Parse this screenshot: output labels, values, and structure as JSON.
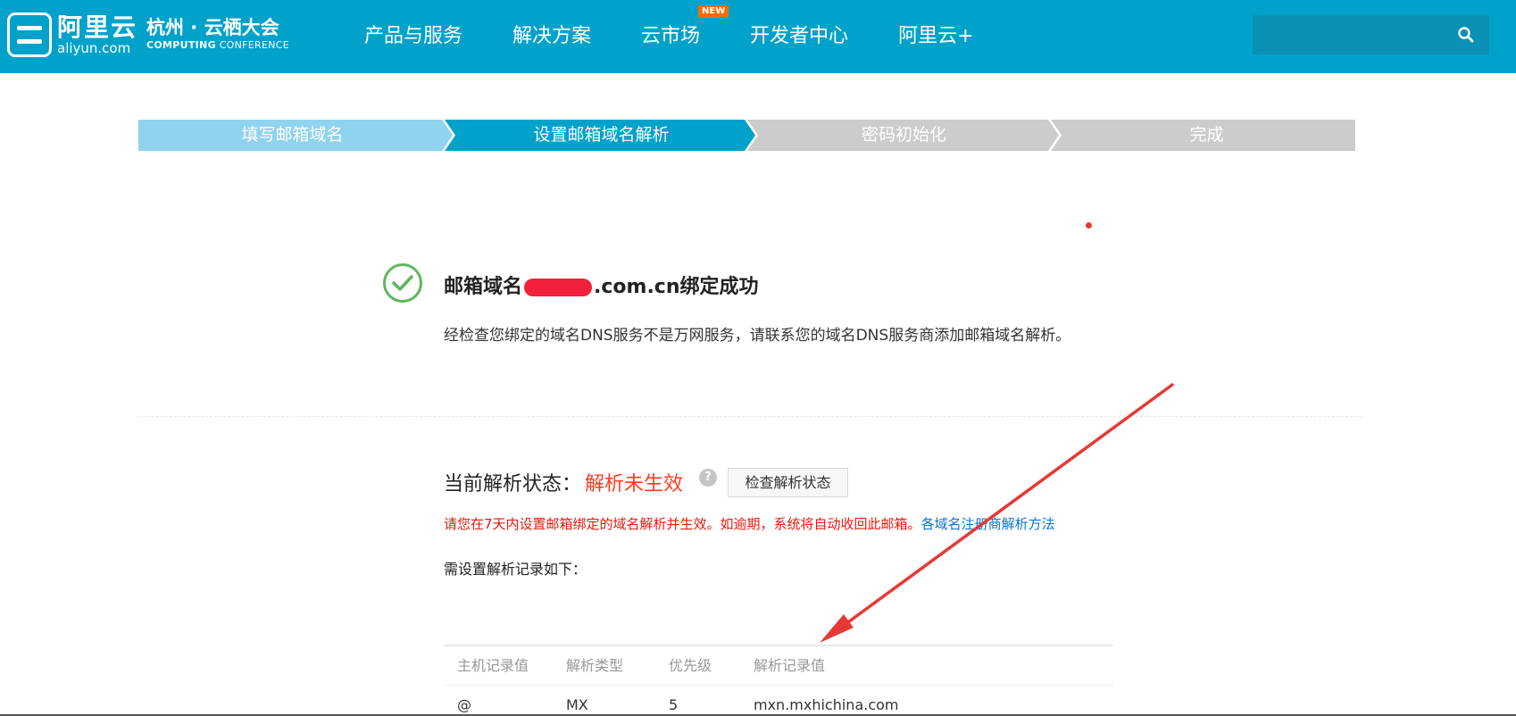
{
  "header": {
    "logo_cn": "阿里云",
    "logo_en": "aliyun.com",
    "conference_cn": "杭州 · 云栖大会",
    "conference_en_bold": "COMPUTING",
    "conference_en_light": " CONFERENCE",
    "nav": [
      {
        "label": "产品与服务"
      },
      {
        "label": "解决方案"
      },
      {
        "label": "云市场",
        "badge": "NEW"
      },
      {
        "label": "开发者中心"
      },
      {
        "label": "阿里云+"
      }
    ],
    "search_placeholder": "",
    "colors": {
      "header_bg": "#00a2ca",
      "search_bg": "#0a91b5",
      "badge": "#ff6a00"
    }
  },
  "steps": [
    {
      "label": "填写邮箱域名",
      "state": "done"
    },
    {
      "label": "设置邮箱域名解析",
      "state": "active"
    },
    {
      "label": "密码初始化",
      "state": "pending"
    },
    {
      "label": "完成",
      "state": "pending"
    }
  ],
  "result": {
    "title_prefix": "邮箱域名",
    "title_suffix": ".com.cn绑定成功",
    "description": "经检查您绑定的域名DNS服务不是万网服务，请联系您的域名DNS服务商添加邮箱域名解析。"
  },
  "status": {
    "label": "当前解析状态：",
    "value": "解析未生效",
    "help_icon": "?",
    "check_button": "检查解析状态",
    "warning": "请您在7天内设置邮箱绑定的域名解析并生效。如逾期，系统将自动收回此邮箱。",
    "warning_link": "各域名注册商解析方法",
    "need_text": "需设置解析记录如下："
  },
  "table": {
    "headers": [
      "主机记录值",
      "解析类型",
      "优先级",
      "解析记录值"
    ],
    "rows": [
      [
        "@",
        "MX",
        "5",
        "mxn.mxhichina.com"
      ]
    ]
  }
}
